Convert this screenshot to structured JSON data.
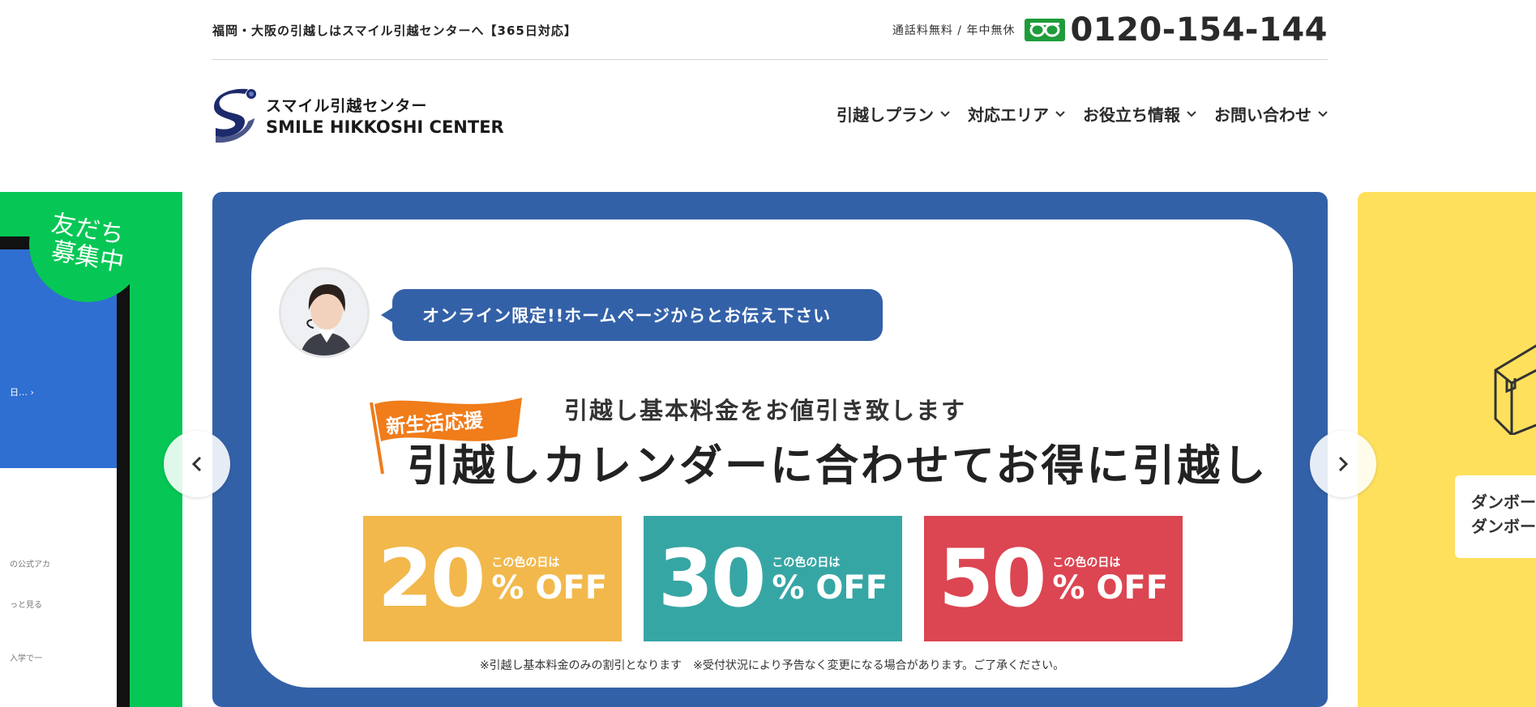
{
  "topbar": {
    "tagline": "福岡・大阪の引越しはスマイル引越センターへ【365日対応】",
    "contact_note": "通話料無料 / 年中無休",
    "phone": "0120-154-144"
  },
  "brand": {
    "name_jp": "スマイル引越センター",
    "name_en": "SMILE HIKKOSHI CENTER",
    "colors": {
      "navy": "#1d2a6b",
      "accent": "#3361a8"
    }
  },
  "nav": {
    "items": [
      {
        "label": "引越しプラン"
      },
      {
        "label": "対応エリア"
      },
      {
        "label": "お役立ち情報"
      },
      {
        "label": "お問い合わせ"
      }
    ]
  },
  "slider": {
    "prev_slide": {
      "badge_line1": "友だち",
      "badge_line2": "募集中",
      "link_text": "日… ›",
      "line1": "の公式アカ",
      "line2": "っと見る",
      "line3": "入学で一",
      "color": "#06c755"
    },
    "current": {
      "bubble": "オンライン限定!!ホームページからとお伝え下さい",
      "flag": "新生活応援",
      "sub_headline": "引越し基本料金をお値引き致します",
      "headline": "引越しカレンダーに合わせてお得に引越し",
      "discounts": [
        {
          "value": "20",
          "label": "この色の日は",
          "off": "% OFF",
          "color": "#f2b84b"
        },
        {
          "value": "30",
          "label": "この色の日は",
          "off": "% OFF",
          "color": "#36a6a4"
        },
        {
          "value": "50",
          "label": "この色の日は",
          "off": "% OFF",
          "color": "#dc4552"
        }
      ],
      "note": "※引越し基本料金のみの割引となります　※受付状況により予告なく変更になる場合があります。ご了承ください。"
    },
    "next_slide": {
      "line1": "ダンボー",
      "line2": "ダンボー",
      "color": "#ffe05d"
    }
  }
}
